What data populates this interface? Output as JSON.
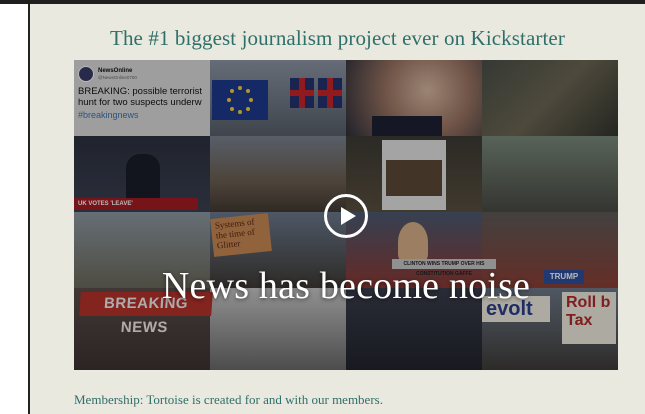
{
  "page": {
    "title": "The #1 biggest journalism project ever on Kickstarter",
    "membership_text": "Membership: Tortoise is created for and with our members."
  },
  "video": {
    "overlay_text": "News has become noise",
    "play_icon": "play-icon",
    "tweet": {
      "account": "NewsOnline",
      "handle": "@NewsOnline0700",
      "text": "BREAKING: possible terrorist hunt for two suspects underw",
      "hashtag": "#breakingnews"
    },
    "tv_banners": {
      "uk_votes": "UK VOTES 'LEAVE'",
      "breaking_news": "BREAKING NEWS",
      "clinton": "CLINTON WINS TRUMP OVER HIS CONSTITUTION GAFFE"
    },
    "signs": {
      "trump": "TRUMP",
      "placard": "Systems of the time of Glitter",
      "evolt": "evolt",
      "rollback": "Roll b Tax"
    }
  },
  "colors": {
    "accent": "#2f6f6a",
    "panel_background": "#e9e9df",
    "top_rule": "#1f1f1f"
  }
}
